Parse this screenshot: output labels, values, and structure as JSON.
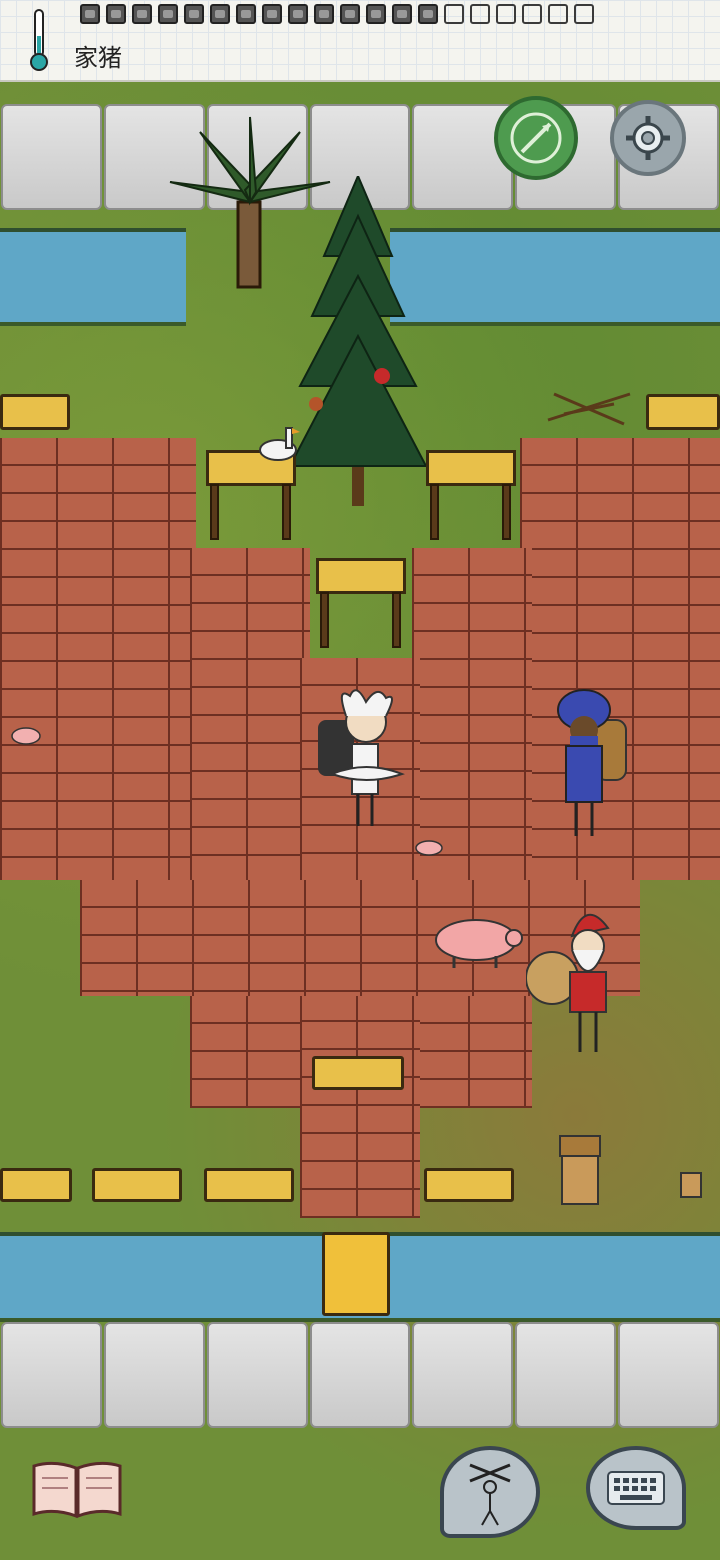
{
  "hud": {
    "region_label": "家猪",
    "slots_filled": 14,
    "slots_total": 20
  },
  "colors": {
    "compass_green": "#4e9b4f",
    "settings_gray": "#9aa6ac",
    "brick": "#b8624a",
    "water": "#5fa7c7"
  },
  "icons": {
    "thermometer": "thermometer-icon",
    "compass": "compass-icon",
    "settings": "gear-icon",
    "book": "book-icon",
    "emote": "puppet-icon",
    "keyboard": "keyboard-icon"
  }
}
